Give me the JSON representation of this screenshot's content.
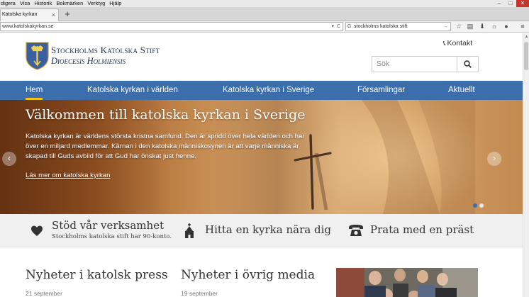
{
  "browser": {
    "menu": [
      "digera",
      "Visa",
      "Historik",
      "Bokmärken",
      "Verktyg",
      "Hjälp"
    ],
    "window_controls": [
      "–",
      "□",
      "✕"
    ],
    "tab_title": "Katolska kyrkan",
    "tab_close": "×",
    "new_tab": "+",
    "url": "www.katolskakyrkan.se",
    "search_query": "stockholms katolska stift"
  },
  "site": {
    "title": "Stockholms Katolska Stift",
    "subtitle": "Dioecesis Holmiensis",
    "contact_label": "Kontakt",
    "search_placeholder": "Sök"
  },
  "nav": {
    "items": [
      "Hem",
      "Katolska kyrkan i världen",
      "Katolska kyrkan i Sverige",
      "Församlingar",
      "Aktuellt"
    ],
    "active": "Hem"
  },
  "hero": {
    "title": "Välkommen till katolska kyrkan i Sverige",
    "text": "Katolska kyrkan är världens största kristna samfund. Den är spridd över hela världen och har över en miljard medlemmar. Kärnan i den katolska människosynen är att varje människa är skapad till Guds avbild för att Gud har önskat just henne.",
    "link": "Läs mer om katolska kyrkan",
    "prev": "‹",
    "next": "›",
    "slides": 2,
    "current_slide": 1
  },
  "services": [
    {
      "title": "Stöd vår verksamhet",
      "subtitle": "Stockholms katolska stift har 90-konto.",
      "icon": "heart-icon"
    },
    {
      "title": "Hitta en kyrka nära dig",
      "icon": "church-icon"
    },
    {
      "title": "Prata med en präst",
      "icon": "phone-icon"
    }
  ],
  "news": [
    {
      "heading": "Nyheter i katolsk press",
      "date": "21 september"
    },
    {
      "heading": "Nyheter i övrig media",
      "date": "19 september"
    }
  ],
  "colors": {
    "nav_bg": "#3d6eac",
    "nav_active_underline": "#f0c419",
    "title_text": "#1d2b4f"
  }
}
